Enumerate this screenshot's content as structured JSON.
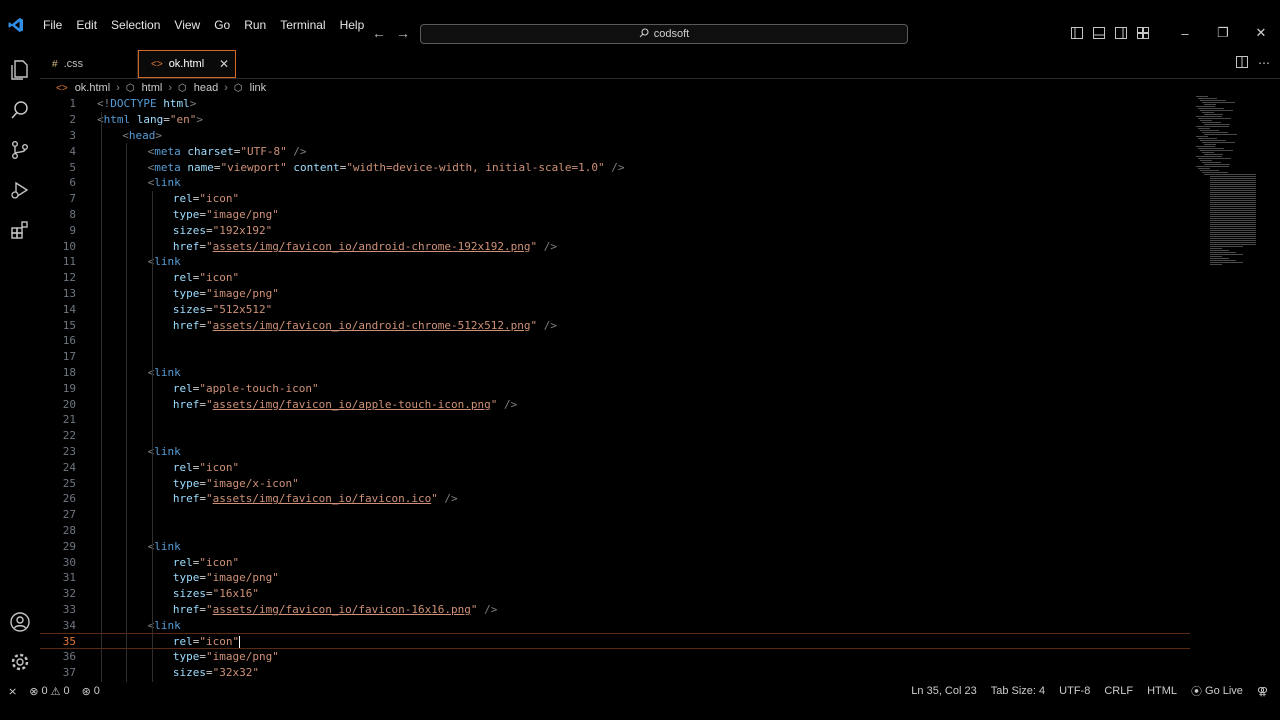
{
  "menu": [
    "File",
    "Edit",
    "Selection",
    "View",
    "Go",
    "Run",
    "Terminal",
    "Help"
  ],
  "command_center": {
    "text": "codsoft"
  },
  "tabs": [
    {
      "label": ".css",
      "icon": "#"
    },
    {
      "label": "ok.html",
      "icon": "<>"
    }
  ],
  "breadcrumb": [
    "ok.html",
    "html",
    "head",
    "link"
  ],
  "status": {
    "errors": "0",
    "warnings": "0",
    "ports": "0",
    "cursor": "Ln 35, Col 23",
    "tab_size": "Tab Size: 4",
    "encoding": "UTF-8",
    "eol": "CRLF",
    "language": "HTML",
    "live": "Go Live"
  },
  "colors": {
    "accent": "#e37933",
    "background": "#000000",
    "tag": "#569cd6",
    "attr": "#9cdcfe",
    "string": "#ce9178"
  },
  "code_lines": [
    {
      "n": "1",
      "indent": 0,
      "tokens": [
        [
          "tag",
          "<!"
        ],
        [
          "kw",
          "DOCTYPE"
        ],
        [
          "attr",
          " html"
        ],
        [
          "tag",
          ">"
        ]
      ]
    },
    {
      "n": "2",
      "indent": 0,
      "tokens": [
        [
          "tag",
          "<"
        ],
        [
          "name",
          "html"
        ],
        [
          "attr",
          " lang"
        ],
        [
          "eq",
          "="
        ],
        [
          "str",
          "\"en\""
        ],
        [
          "tag",
          ">"
        ]
      ]
    },
    {
      "n": "3",
      "indent": 1,
      "tokens": [
        [
          "tag",
          "<"
        ],
        [
          "name",
          "head"
        ],
        [
          "tag",
          ">"
        ]
      ]
    },
    {
      "n": "4",
      "indent": 2,
      "tokens": [
        [
          "tag",
          "<"
        ],
        [
          "name",
          "meta"
        ],
        [
          "attr",
          " charset"
        ],
        [
          "eq",
          "="
        ],
        [
          "str",
          "\"UTF-8\""
        ],
        [
          "tag",
          " />"
        ]
      ]
    },
    {
      "n": "5",
      "indent": 2,
      "tokens": [
        [
          "tag",
          "<"
        ],
        [
          "name",
          "meta"
        ],
        [
          "attr",
          " name"
        ],
        [
          "eq",
          "="
        ],
        [
          "str",
          "\"viewport\""
        ],
        [
          "attr",
          " content"
        ],
        [
          "eq",
          "="
        ],
        [
          "str",
          "\"width=device-width, initial-scale=1.0\""
        ],
        [
          "tag",
          " />"
        ]
      ]
    },
    {
      "n": "6",
      "indent": 2,
      "tokens": [
        [
          "tag",
          "<"
        ],
        [
          "name",
          "link"
        ]
      ]
    },
    {
      "n": "7",
      "indent": 3,
      "tokens": [
        [
          "attr",
          "rel"
        ],
        [
          "eq",
          "="
        ],
        [
          "str",
          "\"icon\""
        ]
      ]
    },
    {
      "n": "8",
      "indent": 3,
      "tokens": [
        [
          "attr",
          "type"
        ],
        [
          "eq",
          "="
        ],
        [
          "str",
          "\"image/png\""
        ]
      ]
    },
    {
      "n": "9",
      "indent": 3,
      "tokens": [
        [
          "attr",
          "sizes"
        ],
        [
          "eq",
          "="
        ],
        [
          "str",
          "\"192x192\""
        ]
      ]
    },
    {
      "n": "10",
      "indent": 3,
      "tokens": [
        [
          "attr",
          "href"
        ],
        [
          "eq",
          "="
        ],
        [
          "str",
          "\""
        ],
        [
          "link",
          "assets/img/favicon_io/android-chrome-192x192.png"
        ],
        [
          "str",
          "\""
        ],
        [
          "tag",
          " />"
        ]
      ]
    },
    {
      "n": "11",
      "indent": 2,
      "tokens": [
        [
          "tag",
          "<"
        ],
        [
          "name",
          "link"
        ]
      ]
    },
    {
      "n": "12",
      "indent": 3,
      "tokens": [
        [
          "attr",
          "rel"
        ],
        [
          "eq",
          "="
        ],
        [
          "str",
          "\"icon\""
        ]
      ]
    },
    {
      "n": "13",
      "indent": 3,
      "tokens": [
        [
          "attr",
          "type"
        ],
        [
          "eq",
          "="
        ],
        [
          "str",
          "\"image/png\""
        ]
      ]
    },
    {
      "n": "14",
      "indent": 3,
      "tokens": [
        [
          "attr",
          "sizes"
        ],
        [
          "eq",
          "="
        ],
        [
          "str",
          "\"512x512\""
        ]
      ]
    },
    {
      "n": "15",
      "indent": 3,
      "tokens": [
        [
          "attr",
          "href"
        ],
        [
          "eq",
          "="
        ],
        [
          "str",
          "\""
        ],
        [
          "link",
          "assets/img/favicon_io/android-chrome-512x512.png"
        ],
        [
          "str",
          "\""
        ],
        [
          "tag",
          " />"
        ]
      ]
    },
    {
      "n": "16",
      "indent": 2,
      "tokens": []
    },
    {
      "n": "17",
      "indent": 2,
      "tokens": []
    },
    {
      "n": "18",
      "indent": 2,
      "tokens": [
        [
          "tag",
          "<"
        ],
        [
          "name",
          "link"
        ]
      ]
    },
    {
      "n": "19",
      "indent": 3,
      "tokens": [
        [
          "attr",
          "rel"
        ],
        [
          "eq",
          "="
        ],
        [
          "str",
          "\"apple-touch-icon\""
        ]
      ]
    },
    {
      "n": "20",
      "indent": 3,
      "tokens": [
        [
          "attr",
          "href"
        ],
        [
          "eq",
          "="
        ],
        [
          "str",
          "\""
        ],
        [
          "link",
          "assets/img/favicon_io/apple-touch-icon.png"
        ],
        [
          "str",
          "\""
        ],
        [
          "tag",
          " />"
        ]
      ]
    },
    {
      "n": "21",
      "indent": 2,
      "tokens": []
    },
    {
      "n": "22",
      "indent": 2,
      "tokens": []
    },
    {
      "n": "23",
      "indent": 2,
      "tokens": [
        [
          "tag",
          "<"
        ],
        [
          "name",
          "link"
        ]
      ]
    },
    {
      "n": "24",
      "indent": 3,
      "tokens": [
        [
          "attr",
          "rel"
        ],
        [
          "eq",
          "="
        ],
        [
          "str",
          "\"icon\""
        ]
      ]
    },
    {
      "n": "25",
      "indent": 3,
      "tokens": [
        [
          "attr",
          "type"
        ],
        [
          "eq",
          "="
        ],
        [
          "str",
          "\"image/x-icon\""
        ]
      ]
    },
    {
      "n": "26",
      "indent": 3,
      "tokens": [
        [
          "attr",
          "href"
        ],
        [
          "eq",
          "="
        ],
        [
          "str",
          "\""
        ],
        [
          "link",
          "assets/img/favicon_io/favicon.ico"
        ],
        [
          "str",
          "\""
        ],
        [
          "tag",
          " />"
        ]
      ]
    },
    {
      "n": "27",
      "indent": 2,
      "tokens": []
    },
    {
      "n": "28",
      "indent": 2,
      "tokens": []
    },
    {
      "n": "29",
      "indent": 2,
      "tokens": [
        [
          "tag",
          "<"
        ],
        [
          "name",
          "link"
        ]
      ]
    },
    {
      "n": "30",
      "indent": 3,
      "tokens": [
        [
          "attr",
          "rel"
        ],
        [
          "eq",
          "="
        ],
        [
          "str",
          "\"icon\""
        ]
      ]
    },
    {
      "n": "31",
      "indent": 3,
      "tokens": [
        [
          "attr",
          "type"
        ],
        [
          "eq",
          "="
        ],
        [
          "str",
          "\"image/png\""
        ]
      ]
    },
    {
      "n": "32",
      "indent": 3,
      "tokens": [
        [
          "attr",
          "sizes"
        ],
        [
          "eq",
          "="
        ],
        [
          "str",
          "\"16x16\""
        ]
      ]
    },
    {
      "n": "33",
      "indent": 3,
      "tokens": [
        [
          "attr",
          "href"
        ],
        [
          "eq",
          "="
        ],
        [
          "str",
          "\""
        ],
        [
          "link",
          "assets/img/favicon_io/favicon-16x16.png"
        ],
        [
          "str",
          "\""
        ],
        [
          "tag",
          " />"
        ]
      ]
    },
    {
      "n": "34",
      "indent": 2,
      "tokens": [
        [
          "tag",
          "<"
        ],
        [
          "name",
          "link"
        ]
      ]
    },
    {
      "n": "35",
      "indent": 3,
      "current": true,
      "tokens": [
        [
          "attr",
          "rel"
        ],
        [
          "eq",
          "="
        ],
        [
          "str",
          "\"icon\""
        ],
        [
          "cursor",
          ""
        ]
      ]
    },
    {
      "n": "36",
      "indent": 3,
      "tokens": [
        [
          "attr",
          "type"
        ],
        [
          "eq",
          "="
        ],
        [
          "str",
          "\"image/png\""
        ]
      ]
    },
    {
      "n": "37",
      "indent": 3,
      "tokens": [
        [
          "attr",
          "sizes"
        ],
        [
          "eq",
          "="
        ],
        [
          "str",
          "\"32x32\""
        ]
      ]
    }
  ]
}
